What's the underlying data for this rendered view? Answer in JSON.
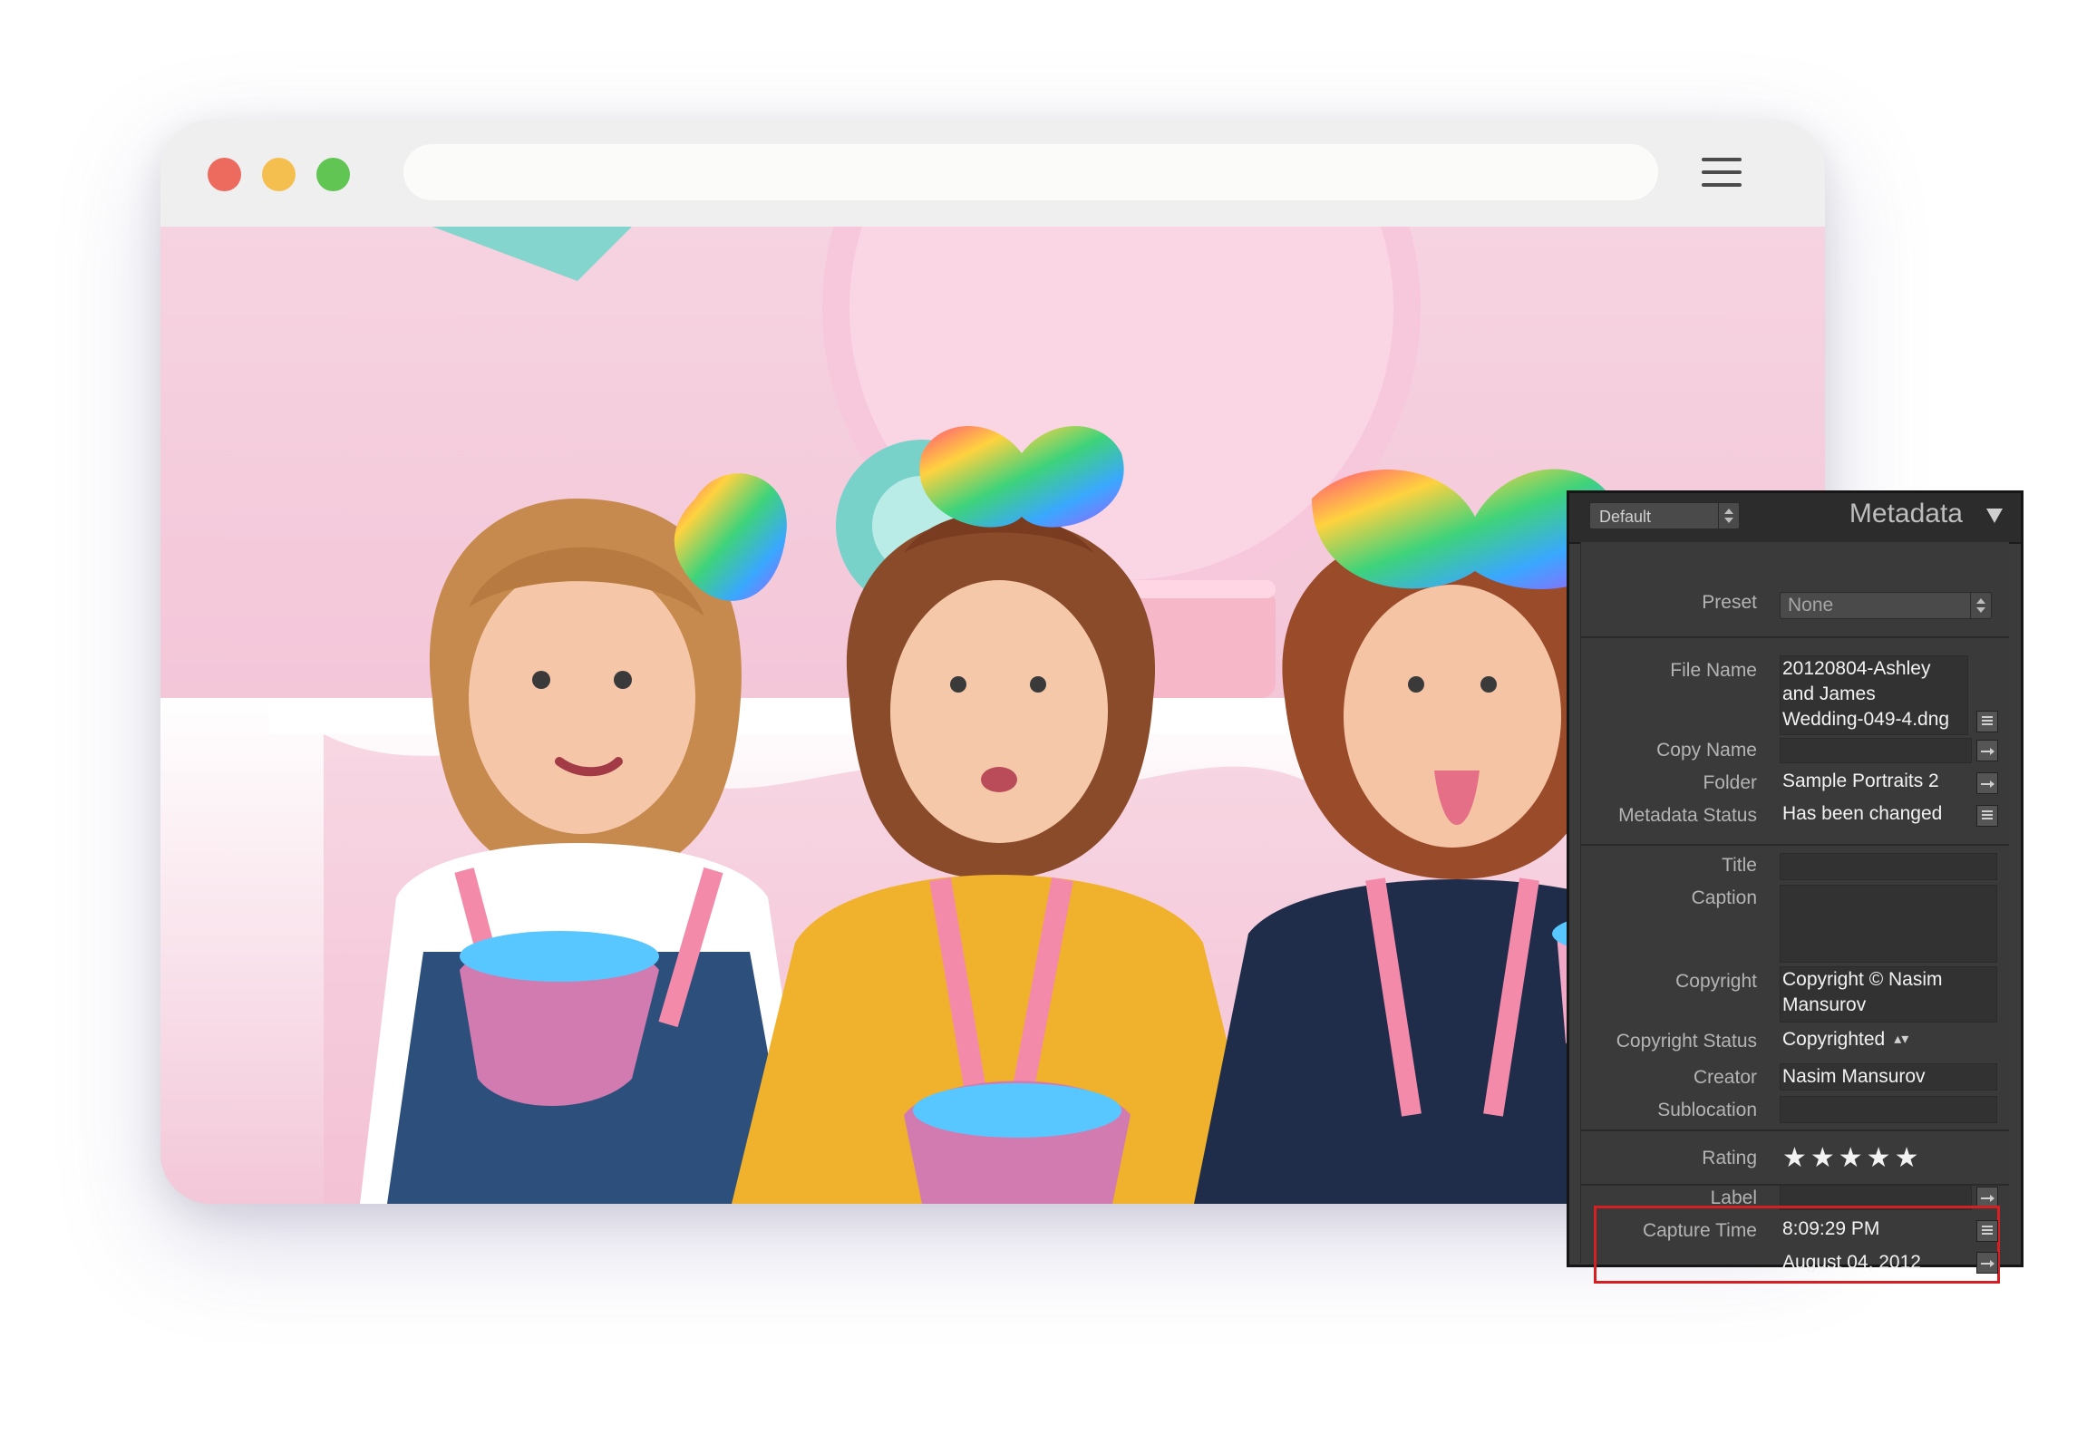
{
  "browser": {
    "url": ""
  },
  "photo": {
    "alt": ""
  },
  "metadata_panel": {
    "header": {
      "preset_dropdown": "Default",
      "title": "Metadata"
    },
    "preset": {
      "label": "Preset",
      "value": "None"
    },
    "file_name": {
      "label": "File Name",
      "lines": [
        "20120804-Ashley",
        "and James",
        "Wedding-049-4.dng"
      ]
    },
    "copy_name": {
      "label": "Copy Name",
      "value": ""
    },
    "folder": {
      "label": "Folder",
      "value": "Sample Portraits 2"
    },
    "metadata_status": {
      "label": "Metadata Status",
      "value": "Has been changed"
    },
    "title_field": {
      "label": "Title",
      "value": ""
    },
    "caption": {
      "label": "Caption",
      "value": ""
    },
    "copyright": {
      "label": "Copyright",
      "lines": [
        "Copyright © Nasim",
        "Mansurov"
      ]
    },
    "copyright_status": {
      "label": "Copyright Status",
      "value": "Copyrighted"
    },
    "creator": {
      "label": "Creator",
      "value": "Nasim Mansurov"
    },
    "sublocation": {
      "label": "Sublocation",
      "value": ""
    },
    "rating": {
      "label": "Rating",
      "value": "★★★★★",
      "stars": 5
    },
    "label_field": {
      "label": "Label",
      "value": ""
    },
    "capture_time": {
      "label": "Capture Time",
      "time": "8:09:29 PM",
      "date": "August 04, 2012"
    }
  },
  "colors": {
    "highlight_border": "#d51f22",
    "panel_background": "#3a3a3a",
    "traffic_red": "#ec6a5e",
    "traffic_yellow": "#f4bf4f",
    "traffic_green": "#61c554"
  }
}
